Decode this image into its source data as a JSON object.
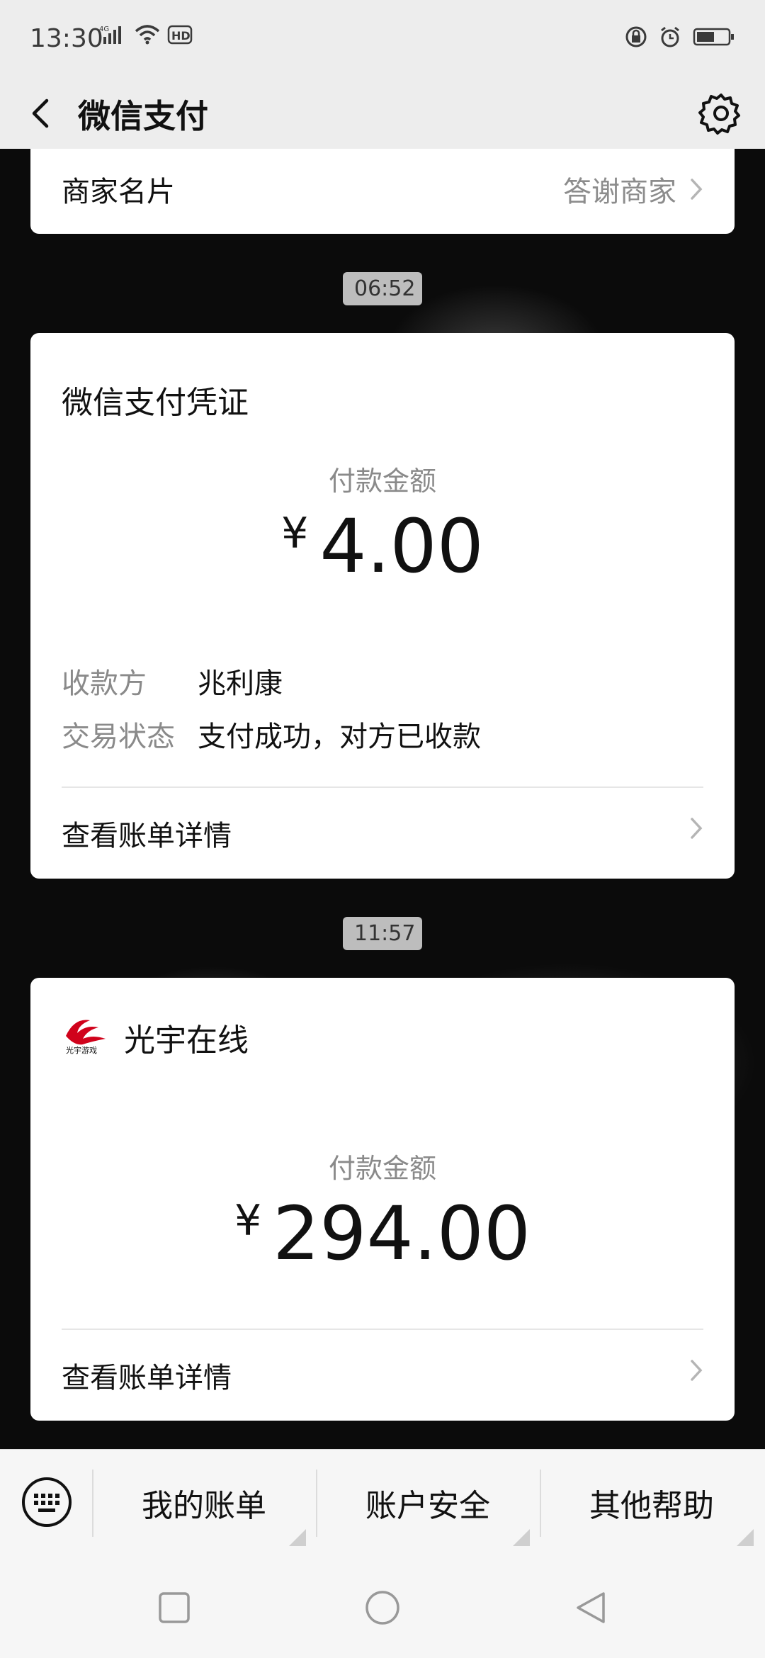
{
  "status_bar": {
    "time": "13:30",
    "net_label": "4G",
    "hd_label": "HD"
  },
  "header": {
    "title": "微信支付"
  },
  "merchant_card": {
    "label": "商家名片",
    "right_text": "答谢商家"
  },
  "timestamps": [
    "06:52",
    "11:57"
  ],
  "receipt": {
    "title": "微信支付凭证",
    "amount_label": "付款金额",
    "currency": "¥",
    "amount": "4.00",
    "payee_key": "收款方",
    "payee_value": "兆利康",
    "status_key": "交易状态",
    "status_value": "支付成功，对方已收款",
    "details_link": "查看账单详情"
  },
  "merchant_payment": {
    "merchant_name": "光宇在线",
    "logo_text": "光宇游戏",
    "amount_label": "付款金额",
    "currency": "¥",
    "amount": "294.00",
    "details_link": "查看账单详情"
  },
  "bottom_menu": {
    "items": [
      "我的账单",
      "账户安全",
      "其他帮助"
    ]
  },
  "icons": {
    "back": "back-arrow-icon",
    "settings": "gear-icon",
    "keyboard": "keyboard-icon",
    "nav": [
      "recent-apps-icon",
      "home-icon",
      "back-icon"
    ]
  },
  "colors": {
    "accent_red": "#d0021b",
    "chip_bg": "#bdbdbd"
  }
}
